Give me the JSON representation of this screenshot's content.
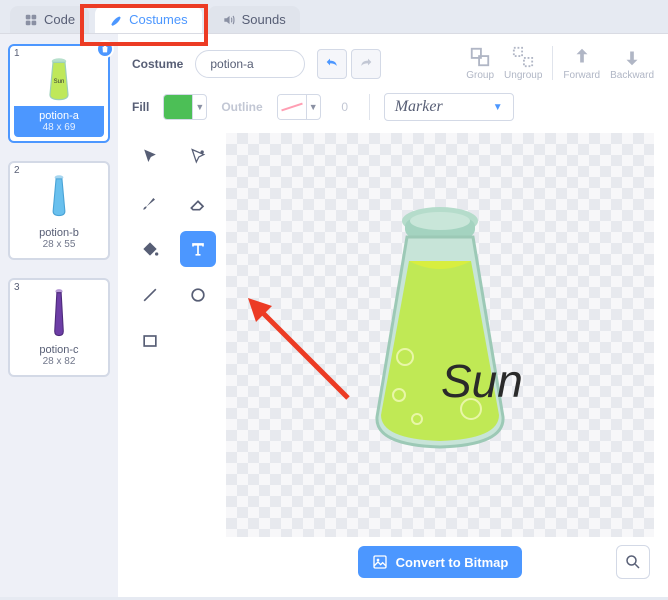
{
  "tabs": {
    "code": "Code",
    "costumes": "Costumes",
    "sounds": "Sounds"
  },
  "sidebar": {
    "items": [
      {
        "name": "potion-a",
        "dimensions": "48 x 69"
      },
      {
        "name": "potion-b",
        "dimensions": "28 x 55"
      },
      {
        "name": "potion-c",
        "dimensions": "28 x 82"
      }
    ]
  },
  "editor": {
    "costume_label": "Costume",
    "costume_name": "potion-a",
    "fill_label": "Fill",
    "fill_color": "#4cbf56",
    "outline_label": "Outline",
    "outline_width": "0",
    "font_name": "Marker",
    "actions": {
      "group": "Group",
      "ungroup": "Ungroup",
      "forward": "Forward",
      "backward": "Backward"
    },
    "convert_label": "Convert to Bitmap",
    "artwork_text": "Sun"
  },
  "tools": {
    "selected": "text",
    "list": [
      "select",
      "reshape",
      "brush",
      "eraser",
      "fill",
      "text",
      "line",
      "circle",
      "rect"
    ]
  }
}
